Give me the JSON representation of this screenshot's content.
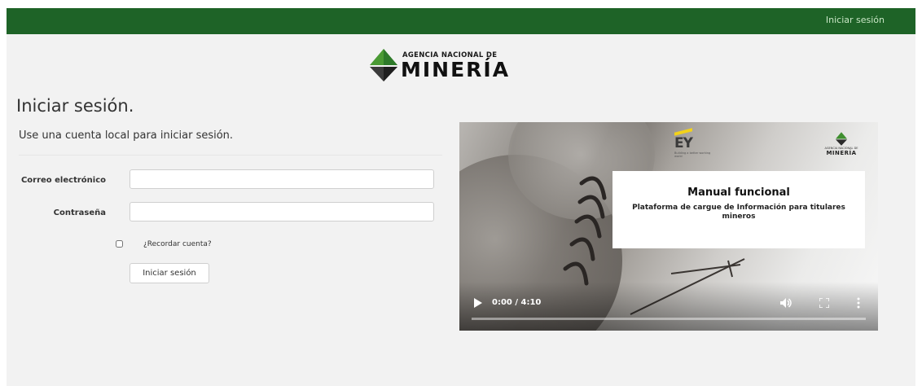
{
  "header": {
    "login_link": "Iniciar sesión"
  },
  "logo": {
    "line1": "AGENCIA NACIONAL DE",
    "line2": "MINERÍA"
  },
  "page": {
    "title": "Iniciar sesión.",
    "subtitle": "Use una cuenta local para iniciar sesión."
  },
  "form": {
    "email_label": "Correo electrónico",
    "email_value": "",
    "password_label": "Contraseña",
    "password_value": "",
    "remember_label": "¿Recordar cuenta?",
    "remember_checked": false,
    "submit_label": "Iniciar sesión"
  },
  "video": {
    "card_title": "Manual funcional",
    "card_subtitle": "Plataforma de cargue de Información para titulares mineros",
    "brand_ey": "EY",
    "ey_tagline": "Building a better working world",
    "mini_logo_small": "AGENCIA NACIONAL DE",
    "mini_logo_big": "MINERÍA",
    "time": "0:00 / 4:10",
    "progress": 0,
    "icons": [
      "play-icon",
      "volume-icon",
      "fullscreen-icon",
      "more-vert-icon"
    ]
  },
  "colors": {
    "header_green": "#1e6327",
    "logo_green_light": "#3f8f2f",
    "logo_green_dark": "#1f5c25",
    "page_bg": "#f2f2f2"
  }
}
